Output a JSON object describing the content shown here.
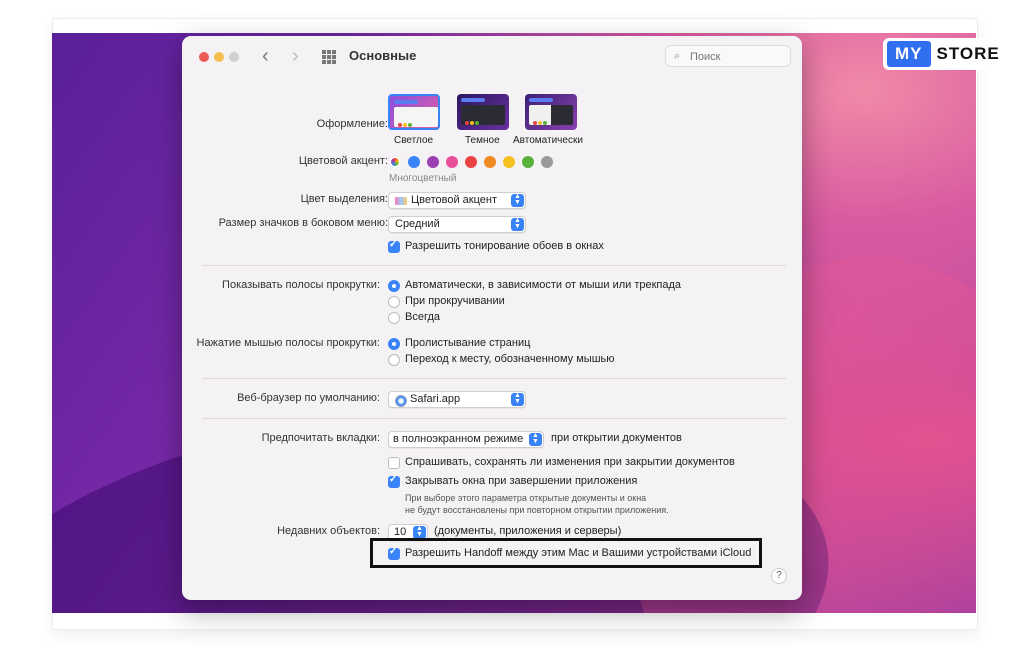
{
  "brand": {
    "my": "MY",
    "store": "STORE"
  },
  "window": {
    "title": "Основные",
    "search_placeholder": "Поиск",
    "back": "‹",
    "forward": "›"
  },
  "appearance": {
    "label": "Оформление:",
    "options": [
      {
        "label": "Светлое",
        "selected": true
      },
      {
        "label": "Темное",
        "selected": false
      },
      {
        "label": "Автоматически",
        "selected": false
      }
    ]
  },
  "accent": {
    "label": "Цветовой акцент:",
    "caption": "Многоцветный",
    "colors": [
      "#9b59d9",
      "#3a83f7",
      "#9a3fb4",
      "#e84f9a",
      "#e84342",
      "#f08a24",
      "#f5c020",
      "#59b33a",
      "#9a9a9a"
    ]
  },
  "highlight_color": {
    "label": "Цвет выделения:",
    "value": "Цветовой акцент"
  },
  "sidebar_icon_size": {
    "label": "Размер значков в боковом меню:",
    "value": "Средний"
  },
  "wallpaper_tint": {
    "label": "Разрешить тонирование обоев в окнах",
    "checked": true
  },
  "show_scrollbars": {
    "label": "Показывать полосы прокрутки:",
    "options": [
      "Автоматически, в зависимости от мыши или трекпада",
      "При прокручивании",
      "Всегда"
    ],
    "selected": 0
  },
  "scrollbar_click": {
    "label": "Нажатие мышью полосы прокрутки:",
    "options": [
      "Пролистывание страниц",
      "Переход к месту, обозначенному мышью"
    ],
    "selected": 0
  },
  "browser": {
    "label": "Веб-браузер по умолчанию:",
    "value": "Safari.app"
  },
  "tabs": {
    "label": "Предпочитать вкладки:",
    "value": "в полноэкранном режиме",
    "suffix": "при открытии документов"
  },
  "ask_save": {
    "label": "Спрашивать, сохранять ли изменения при закрытии документов",
    "checked": false
  },
  "close_windows": {
    "label": "Закрывать окна при завершении приложения",
    "checked": true,
    "note_line1": "При выборе этого параметра открытые документы и окна",
    "note_line2": "не будут восстановлены при повторном открытии приложения."
  },
  "recent": {
    "label": "Недавних объектов:",
    "value": "10",
    "suffix": "(документы, приложения и серверы)"
  },
  "handoff": {
    "label": "Разрешить Handoff между этим Mac и Вашими устройствами iCloud",
    "checked": true
  },
  "help": "?"
}
